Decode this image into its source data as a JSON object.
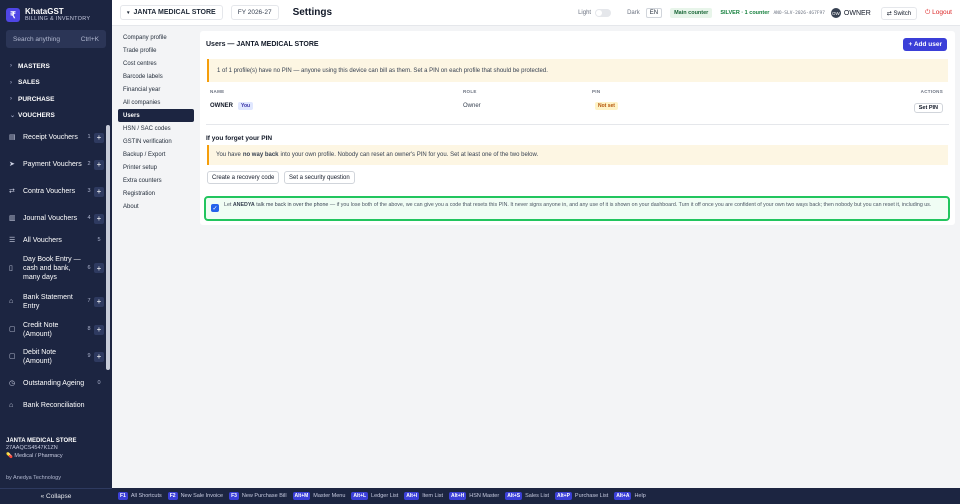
{
  "app": {
    "name": "KhataGST",
    "subtitle": "BILLING & INVENTORY",
    "logo_glyph": "₹"
  },
  "search": {
    "placeholder": "Search anything",
    "shortcut": "Ctrl+K"
  },
  "sidebar": {
    "sections": [
      {
        "label": "MASTERS",
        "icon": "chevron-right"
      },
      {
        "label": "SALES",
        "icon": "chevron-right"
      },
      {
        "label": "PURCHASE",
        "icon": "chevron-right"
      },
      {
        "label": "VOUCHERS",
        "icon": "chevron-down"
      }
    ],
    "vouchers": [
      {
        "label": "Receipt Vouchers",
        "num": "1",
        "icon": "receipt-icon",
        "plus": true
      },
      {
        "label": "Payment Vouchers",
        "num": "2",
        "icon": "send-icon",
        "plus": true
      },
      {
        "label": "Contra Vouchers",
        "num": "3",
        "icon": "swap-icon",
        "plus": true
      },
      {
        "label": "Journal Vouchers",
        "num": "4",
        "icon": "journal-icon",
        "plus": true
      },
      {
        "label": "All Vouchers",
        "num": "5",
        "icon": "list-icon",
        "plus": false
      },
      {
        "label": "Day Book Entry — cash and bank, many days",
        "num": "6",
        "icon": "book-icon",
        "plus": true
      },
      {
        "label": "Bank Statement Entry",
        "num": "7",
        "icon": "bank-icon",
        "plus": true
      },
      {
        "label": "Credit Note (Amount)",
        "num": "8",
        "icon": "note-icon",
        "plus": true
      },
      {
        "label": "Debit Note (Amount)",
        "num": "9",
        "icon": "note-icon",
        "plus": true
      },
      {
        "label": "Outstanding Ageing",
        "num": "0",
        "icon": "clock-icon",
        "plus": false
      },
      {
        "label": "Bank Reconciliation",
        "num": "",
        "icon": "bank-icon",
        "plus": false
      }
    ],
    "store_name": "JANTA MEDICAL STORE",
    "gstin": "27AAQCS4547K1ZN",
    "store_type": "Medical / Pharmacy",
    "by_line": "by Anedya Technology",
    "collapse_label": "« Collapse"
  },
  "topbar": {
    "store": "JANTA MEDICAL STORE",
    "fy": "FY 2026-27",
    "title": "Settings",
    "light_label": "Light",
    "dark_label": "Dark",
    "lang": "EN",
    "counter": "Main counter",
    "license": "SILVER · 1 counter",
    "license_code": "ANO-SLV-2026-4G7F97",
    "avatar": "OW",
    "role": "OWNER",
    "switch_label": "Switch",
    "logout_label": "Logout"
  },
  "settings_nav": [
    "Company profile",
    "Trade profile",
    "Cost centres",
    "Barcode labels",
    "Financial year",
    "All companies",
    "Users",
    "HSN / SAC codes",
    "GSTIN verification",
    "Backup / Export",
    "Printer setup",
    "Extra counters",
    "Registration",
    "About"
  ],
  "settings_active": "Users",
  "users": {
    "title": "Users — JANTA MEDICAL STORE",
    "add_button": "+ Add user",
    "notice": "1 of 1 profile(s) have no PIN — anyone using this device can bill as them. Set a PIN on each profile that should be protected.",
    "columns": {
      "name": "NAME",
      "role": "ROLE",
      "pin": "PIN",
      "actions": "ACTIONS"
    },
    "rows": [
      {
        "name": "OWNER",
        "you": "You",
        "role": "Owner",
        "pin": "Not set",
        "action": "Set PIN"
      }
    ]
  },
  "forget": {
    "heading": "If you forget your PIN",
    "note_pre": "You have",
    "note_bold": "no way back",
    "note_post": "into your own profile. Nobody can reset an owner's PIN for you. Set at least one of the two below.",
    "btn_recovery": "Create a recovery code",
    "btn_question": "Set a security question"
  },
  "anedya": {
    "pre": "Let",
    "bold1": "ANEDYA",
    "mid": "talk me back in over the phone",
    "rest": " — if you lose both of the above, we can give you a code that resets this PIN. It never signs anyone in, and any use of it is shown on your dashboard. Turn it off once you are confident of your own two ways back; then nobody but you can reset it, including us.",
    "checked": true
  },
  "footer": [
    {
      "key": "F1",
      "label": "All Shortcuts"
    },
    {
      "key": "F2",
      "label": "New Sale Invoice"
    },
    {
      "key": "F3",
      "label": "New Purchase Bill"
    },
    {
      "key": "Alt+M",
      "label": "Master Menu"
    },
    {
      "key": "Alt+L",
      "label": "Ledger List"
    },
    {
      "key": "Alt+I",
      "label": "Item List"
    },
    {
      "key": "Alt+H",
      "label": "HSN Master"
    },
    {
      "key": "Alt+S",
      "label": "Sales List"
    },
    {
      "key": "Alt+P",
      "label": "Purchase List"
    },
    {
      "key": "Alt+A",
      "label": "Help"
    }
  ],
  "colors": {
    "sidebar": "#1c2541",
    "accent": "#3b3fd8",
    "highlight": "#22c55e"
  }
}
